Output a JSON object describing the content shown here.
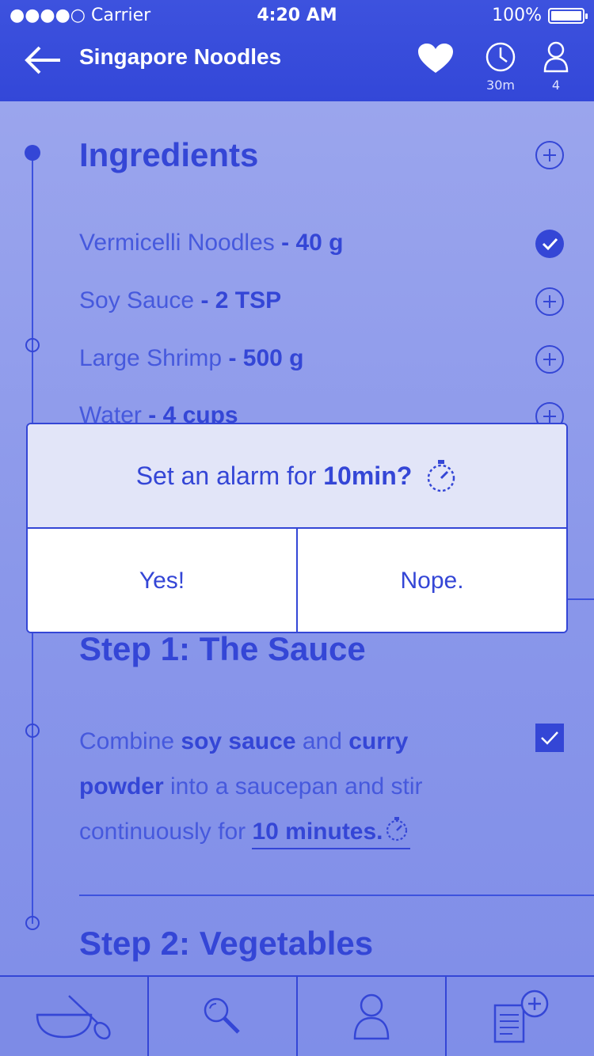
{
  "status_bar": {
    "carrier": "●●●●○ Carrier",
    "time": "4:20 AM",
    "battery": "100%"
  },
  "header": {
    "title": "Singapore Noodles",
    "time_label": "30m",
    "servings": "4"
  },
  "ingredients": {
    "title": "Ingredients",
    "items": [
      {
        "name": "Vermicelli Noodles",
        "amount": "- 40 g",
        "checked": true
      },
      {
        "name": "Soy Sauce",
        "amount": "- 2 TSP",
        "checked": false
      },
      {
        "name": "Large Shrimp",
        "amount": "- 500 g",
        "checked": false
      },
      {
        "name": "Water",
        "amount": "- 4 cups",
        "checked": false
      }
    ]
  },
  "alarm_modal": {
    "prefix": "Set an alarm for",
    "duration": "10min?",
    "yes_label": "Yes!",
    "no_label": "Nope."
  },
  "step1": {
    "title": "Step 1: The Sauce",
    "part1": "Combine ",
    "part2": "soy sauce",
    "part3": " and ",
    "part4": "curry powder",
    "part5": " into a saucepan and stir continuously for ",
    "part6": "10 minutes."
  },
  "step2": {
    "title": "Step 2: Vegetables"
  },
  "tabbar": {
    "tabs": [
      "cook",
      "search",
      "profile",
      "add-recipe"
    ]
  },
  "colors": {
    "accent": "#3446d6",
    "header": "#3d52de",
    "background": "#8a97ea"
  }
}
